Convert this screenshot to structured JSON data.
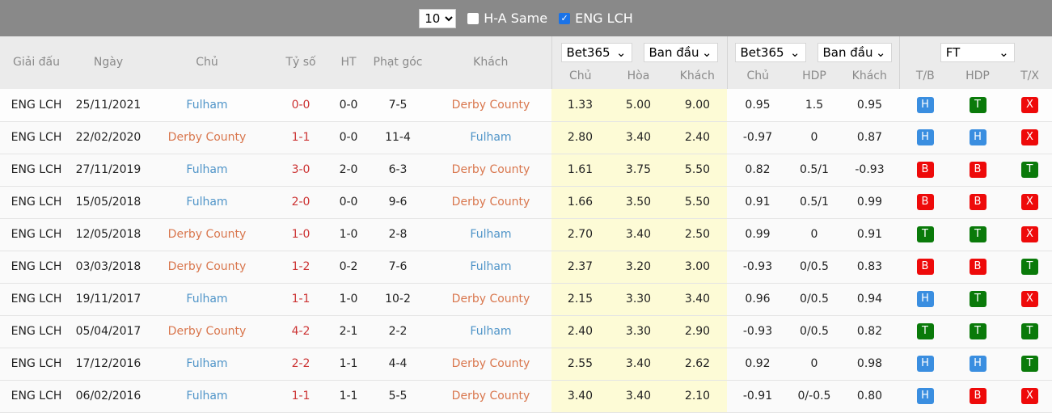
{
  "filter_bar": {
    "count_value": "10",
    "ha_same_label": "H-A Same",
    "ha_same_checked": false,
    "league_label": "ENG LCH",
    "league_checked": true
  },
  "headers": {
    "league": "Giải đấu",
    "date": "Ngày",
    "home": "Chủ",
    "score": "Tỷ số",
    "ht": "HT",
    "corners": "Phạt góc",
    "away": "Khách",
    "odds1x2": {
      "bookmaker": "Bet365",
      "type": "Ban đầu",
      "home": "Chủ",
      "draw": "Hòa",
      "away": "Khách"
    },
    "handicap": {
      "bookmaker": "Bet365",
      "type": "Ban đầu",
      "home": "Chủ",
      "hdp": "HDP",
      "away": "Khách"
    },
    "results": {
      "period": "FT",
      "tb": "T/B",
      "hdp": "HDP",
      "tx": "T/X"
    }
  },
  "colors": {
    "H": "#3a8ee0",
    "T": "#0a7a0a",
    "B": "#ee0a0a",
    "X": "#ee0a0a",
    "fulham": "#4f94c8",
    "derby": "#d9774e"
  },
  "rows": [
    {
      "league": "ENG LCH",
      "date": "25/11/2021",
      "home": "Fulham",
      "score": "0-0",
      "ht": "0-0",
      "corners": "7-5",
      "away": "Derby County",
      "o_home": "1.33",
      "o_draw": "5.00",
      "o_away": "9.00",
      "h_home": "0.95",
      "h_hdp": "1.5",
      "h_away": "0.95",
      "tb": "H",
      "hdp": "T",
      "tx": "X"
    },
    {
      "league": "ENG LCH",
      "date": "22/02/2020",
      "home": "Derby County",
      "score": "1-1",
      "ht": "0-0",
      "corners": "11-4",
      "away": "Fulham",
      "o_home": "2.80",
      "o_draw": "3.40",
      "o_away": "2.40",
      "h_home": "-0.97",
      "h_hdp": "0",
      "h_away": "0.87",
      "tb": "H",
      "hdp": "H",
      "tx": "X"
    },
    {
      "league": "ENG LCH",
      "date": "27/11/2019",
      "home": "Fulham",
      "score": "3-0",
      "ht": "2-0",
      "corners": "6-3",
      "away": "Derby County",
      "o_home": "1.61",
      "o_draw": "3.75",
      "o_away": "5.50",
      "h_home": "0.82",
      "h_hdp": "0.5/1",
      "h_away": "-0.93",
      "tb": "B",
      "hdp": "B",
      "tx": "T"
    },
    {
      "league": "ENG LCH",
      "date": "15/05/2018",
      "home": "Fulham",
      "score": "2-0",
      "ht": "0-0",
      "corners": "9-6",
      "away": "Derby County",
      "o_home": "1.66",
      "o_draw": "3.50",
      "o_away": "5.50",
      "h_home": "0.91",
      "h_hdp": "0.5/1",
      "h_away": "0.99",
      "tb": "B",
      "hdp": "B",
      "tx": "X"
    },
    {
      "league": "ENG LCH",
      "date": "12/05/2018",
      "home": "Derby County",
      "score": "1-0",
      "ht": "1-0",
      "corners": "2-8",
      "away": "Fulham",
      "o_home": "2.70",
      "o_draw": "3.40",
      "o_away": "2.50",
      "h_home": "0.99",
      "h_hdp": "0",
      "h_away": "0.91",
      "tb": "T",
      "hdp": "T",
      "tx": "X"
    },
    {
      "league": "ENG LCH",
      "date": "03/03/2018",
      "home": "Derby County",
      "score": "1-2",
      "ht": "0-2",
      "corners": "7-6",
      "away": "Fulham",
      "o_home": "2.37",
      "o_draw": "3.20",
      "o_away": "3.00",
      "h_home": "-0.93",
      "h_hdp": "0/0.5",
      "h_away": "0.83",
      "tb": "B",
      "hdp": "B",
      "tx": "T"
    },
    {
      "league": "ENG LCH",
      "date": "19/11/2017",
      "home": "Fulham",
      "score": "1-1",
      "ht": "1-0",
      "corners": "10-2",
      "away": "Derby County",
      "o_home": "2.15",
      "o_draw": "3.30",
      "o_away": "3.40",
      "h_home": "0.96",
      "h_hdp": "0/0.5",
      "h_away": "0.94",
      "tb": "H",
      "hdp": "T",
      "tx": "X"
    },
    {
      "league": "ENG LCH",
      "date": "05/04/2017",
      "home": "Derby County",
      "score": "4-2",
      "ht": "2-1",
      "corners": "2-2",
      "away": "Fulham",
      "o_home": "2.40",
      "o_draw": "3.30",
      "o_away": "2.90",
      "h_home": "-0.93",
      "h_hdp": "0/0.5",
      "h_away": "0.82",
      "tb": "T",
      "hdp": "T",
      "tx": "T"
    },
    {
      "league": "ENG LCH",
      "date": "17/12/2016",
      "home": "Fulham",
      "score": "2-2",
      "ht": "1-1",
      "corners": "4-4",
      "away": "Derby County",
      "o_home": "2.55",
      "o_draw": "3.40",
      "o_away": "2.62",
      "h_home": "0.92",
      "h_hdp": "0",
      "h_away": "0.98",
      "tb": "H",
      "hdp": "H",
      "tx": "T"
    },
    {
      "league": "ENG LCH",
      "date": "06/02/2016",
      "home": "Fulham",
      "score": "1-1",
      "ht": "1-1",
      "corners": "5-5",
      "away": "Derby County",
      "o_home": "3.40",
      "o_draw": "3.40",
      "o_away": "2.10",
      "h_home": "-0.91",
      "h_hdp": "0/-0.5",
      "h_away": "0.80",
      "tb": "H",
      "hdp": "B",
      "tx": "X"
    }
  ]
}
